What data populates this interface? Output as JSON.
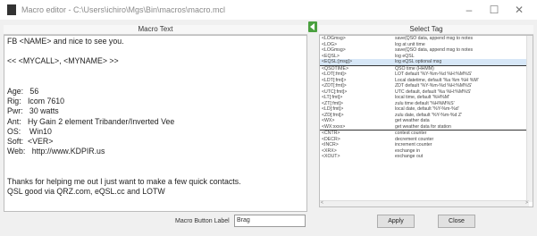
{
  "window": {
    "title": "Macro editor - C:\\Users\\ichiro\\Mgs\\Bin\\macros\\macro.mcl",
    "minimize": "–",
    "maximize": "☐",
    "close": "✕"
  },
  "macro_header": "Macro Text",
  "tag_header": "Select Tag",
  "macro_lines": [
    "FB <NAME> and nice to see you.",
    "",
    "<< <MYCALL>, <MYNAME> >>",
    "",
    "",
    "Age:   56",
    "Rig:   Icom 7610",
    "Pwr:   30 watts",
    "Ant:   Hy Gain 2 element Tribander/Inverted Vee",
    "OS:    Win10",
    "Soft:  <VER>",
    "Web:   http://www.KDPIR.us",
    "",
    "",
    "Thanks for helping me out I just want to make a few quick contacts.",
    "QSL good via QRZ.com, eQSL.cc and LOTW"
  ],
  "tags": [
    {
      "name": "<LOGmsg>",
      "desc": "save(QSO data, append msg to notes",
      "sep": false,
      "sel": false
    },
    {
      "name": "<LOG>",
      "desc": "log at unit time",
      "sep": false,
      "sel": false
    },
    {
      "name": "<LOGmsg>",
      "desc": "save(QSO data, append msg to notes",
      "sep": false,
      "sel": false
    },
    {
      "name": "<EQSL>",
      "desc": "log eQSL",
      "sep": false,
      "sel": false
    },
    {
      "name": "<EQSL:[msg]>",
      "desc": "log eQSL optional msg",
      "sep": false,
      "sel": true
    },
    {
      "name": "<QSOTIME>",
      "desc": "QSO time (HHMM)",
      "sep": true,
      "sel": false
    },
    {
      "name": "<LOT[:fmt]>",
      "desc": "LOT default '%Y-%m-%d %H:%M%S'",
      "sep": false,
      "sel": false
    },
    {
      "name": "<LDT[:fmt]>",
      "desc": "Local datetime, default '%a %m %H %M'",
      "sep": false,
      "sel": false
    },
    {
      "name": "<ZDT[:fmt]>",
      "desc": "ZDT default '%Y-%m-%d %H:%M%S'",
      "sep": false,
      "sel": false
    },
    {
      "name": "<UTC[:fmt]>",
      "desc": "UTC default, default '%a %H:%M%S'",
      "sep": false,
      "sel": false
    },
    {
      "name": "<LT[:fmt]>",
      "desc": "local time, default '%H%M'",
      "sep": false,
      "sel": false
    },
    {
      "name": "<ZT[:fmt]>",
      "desc": "zulu time default '%H%M%S'",
      "sep": false,
      "sel": false
    },
    {
      "name": "<LD[:fmt]>",
      "desc": "local date, default '%Y-%m-%d'",
      "sep": false,
      "sel": false
    },
    {
      "name": "<ZD[:fmt]>",
      "desc": "zulu date, default '%Y-%m-%d Z'",
      "sep": false,
      "sel": false
    },
    {
      "name": "<WX>",
      "desc": "get weather data",
      "sep": false,
      "sel": false
    },
    {
      "name": "<WX:xxxx>",
      "desc": "get weather data for station",
      "sep": false,
      "sel": false
    },
    {
      "name": "<CNTR>",
      "desc": "contest counter",
      "sep": true,
      "sel": false
    },
    {
      "name": "<DECR>",
      "desc": "decrement counter",
      "sep": false,
      "sel": false
    },
    {
      "name": "<INCR>",
      "desc": "increment counter",
      "sep": false,
      "sel": false
    },
    {
      "name": "<XRX>",
      "desc": "exchange in",
      "sep": false,
      "sel": false
    },
    {
      "name": "<XOUT>",
      "desc": "exchange out",
      "sep": false,
      "sel": false
    }
  ],
  "scroll_left": "<",
  "scroll_right": ">",
  "bottom": {
    "label": "Macro Button Label",
    "name_value": "Brag",
    "apply": "Apply",
    "close": "Close"
  }
}
